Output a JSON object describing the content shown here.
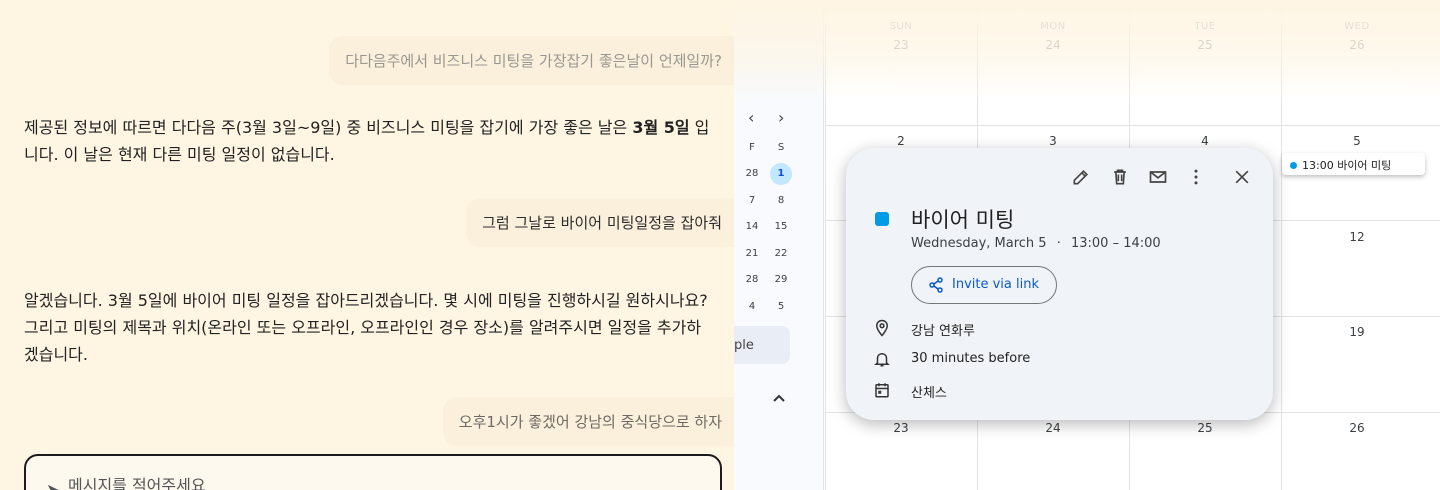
{
  "chat": {
    "user_msg_1": "다다음주에서 비즈니스 미팅을 가장잡기 좋은날이 언제일까?",
    "ai_msg_1_line1_pre": "제공된 정보에 따르면 다다음 주(3월 3일~9일) 중 비즈니스 미팅을 잡기에 가장 좋은 날은 ",
    "ai_msg_1_bold": "3월 5일",
    "ai_msg_1_line1_post": " 입",
    "ai_msg_1_line2": "니다.  이 날은 현재 다른 미팅 일정이 없습니다.",
    "user_msg_2": "그럼 그날로 바이어 미팅일정을 잡아줘",
    "ai_msg_2_line1": "알겠습니다. 3월 5일에 바이어 미팅 일정을 잡아드리겠습니다.  몇 시에 미팅을 진행하시길 원하시나요?",
    "ai_msg_2_line2": "그리고 미팅의 제목과 위치(온라인 또는 오프라인, 오프라인인 경우 장소)를 알려주시면 일정을 추가하",
    "ai_msg_2_line3": "겠습니다.",
    "user_msg_3": "오후1시가 좋겠어 강남의 중식당으로 하자",
    "input_placeholder": "메시지를 적어주세요"
  },
  "mini_calendar": {
    "prev": "‹",
    "next": "›",
    "col_headers": [
      "F",
      "S"
    ],
    "rows": [
      [
        "28",
        "1"
      ],
      [
        "7",
        "8"
      ],
      [
        "14",
        "15"
      ],
      [
        "21",
        "22"
      ],
      [
        "28",
        "29"
      ],
      [
        "4",
        "5"
      ]
    ],
    "selected": "1",
    "people_label": "ple",
    "collapse_icon": "chevron-up-icon"
  },
  "month_view": {
    "weekdays": [
      "SUN",
      "MON",
      "TUE",
      "WED"
    ],
    "weeks": [
      [
        "23",
        "24",
        "25",
        "26"
      ],
      [
        "2",
        "3",
        "4",
        "5"
      ],
      [
        "",
        "",
        "",
        "12"
      ],
      [
        "",
        "",
        "",
        "19"
      ],
      [
        "23",
        "24",
        "25",
        "26"
      ]
    ]
  },
  "event_chip": {
    "label": "13:00 바이어 미팅",
    "color": "#039be5"
  },
  "event_popup": {
    "title": "바이어 미팅",
    "date": "Wednesday, March 5",
    "separator": "·",
    "time": "13:00 – 14:00",
    "invite_label": "Invite via link",
    "location": "강남 연화루",
    "reminder": "30 minutes before",
    "calendar_name": "산체스",
    "color": "#039be5",
    "actions": [
      "edit-icon",
      "delete-icon",
      "email-icon",
      "more-options-icon",
      "close-icon"
    ]
  }
}
